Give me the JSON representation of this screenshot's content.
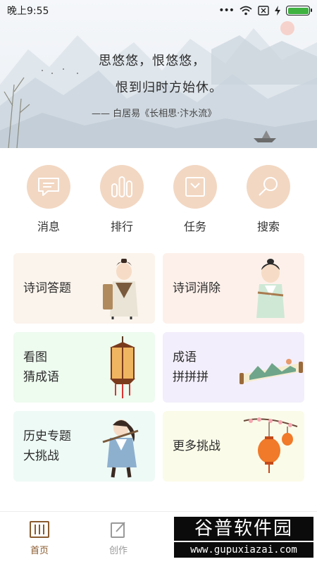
{
  "status_bar": {
    "time": "晚上9:55"
  },
  "hero": {
    "line1": "思悠悠，恨悠悠，",
    "line2": "恨到归时方始休。",
    "source": "—— 白居易《长相思·汴水流》"
  },
  "quick_actions": [
    {
      "label": "消息",
      "icon": "message-icon"
    },
    {
      "label": "排行",
      "icon": "ranking-icon"
    },
    {
      "label": "任务",
      "icon": "task-icon"
    },
    {
      "label": "搜索",
      "icon": "search-icon"
    }
  ],
  "cards": [
    {
      "line1": "诗词答题",
      "line2": "",
      "bg": "#fbf4ec"
    },
    {
      "line1": "诗词消除",
      "line2": "",
      "bg": "#fdf0ea"
    },
    {
      "line1": "看图",
      "line2": "猜成语",
      "bg": "#eefbef"
    },
    {
      "line1": "成语",
      "line2": "拼拼拼",
      "bg": "#f3eefb"
    },
    {
      "line1": "历史专题",
      "line2": "大挑战",
      "bg": "#eefaf6"
    },
    {
      "line1": "更多挑战",
      "line2": "",
      "bg": "#fbfbe9"
    }
  ],
  "bottom_nav": [
    {
      "label": "首页",
      "active": true
    },
    {
      "label": "创作",
      "active": false
    }
  ],
  "watermark": {
    "top": "谷普软件园",
    "bottom": "www.gupuxiazai.com"
  },
  "colors": {
    "accent": "#8a5a2e",
    "circle": "#f2d7c2",
    "inactive": "#999999"
  }
}
